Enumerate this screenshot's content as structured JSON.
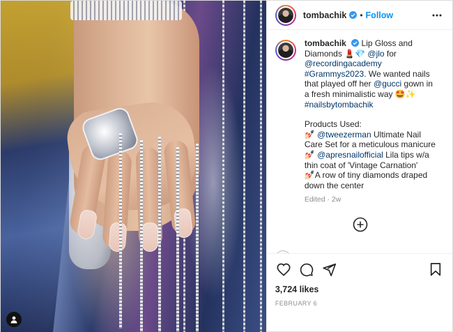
{
  "post": {
    "username": "tombachik",
    "follow_label": "Follow",
    "separator": "•",
    "caption": {
      "username": "tombachik",
      "line1": "Lip Gloss and Diamonds 💄💎 ",
      "mention_jlo": "@jlo",
      "for": " for ",
      "mention_academy": "@recordingacademy",
      "hashtag_grammys": "#Grammys2023",
      "text2": ". We wanted nails that played off her ",
      "mention_gucci": "@gucci",
      "text3": " gown in a fresh minimalistic way 🤩✨",
      "hashtag_nails": "#nailsbytombachik",
      "products_heading": "Products Used:",
      "item1_emoji": "💅🏻 ",
      "mention_tweezerman": "@tweezerman",
      "item1_text": " Ultimate Nail Care Set for a meticulous manicure",
      "item2_emoji": "💅🏻 ",
      "mention_apres": "@apresnailofficial",
      "item2_text": " Lila tips w/a thin coat of 'Vintage Carnation'",
      "item3_emoji": "💅🏻",
      "item3_text": "A row of tiny diamonds draped down the center"
    },
    "edited": "Edited · 2w",
    "likes": "3,724 likes",
    "date": "FEBRUARY 6"
  },
  "icons": {
    "verified": "verified-badge-icon",
    "more": "more-options-icon",
    "add": "add-comment-plus-icon",
    "like": "heart-icon",
    "comment": "comment-bubble-icon",
    "share": "share-paper-plane-icon",
    "save": "bookmark-icon",
    "tag": "user-tag-icon"
  },
  "colors": {
    "link": "#00376b",
    "follow": "#0095f6",
    "verified": "#3897f0",
    "muted": "#8e8e8e"
  }
}
